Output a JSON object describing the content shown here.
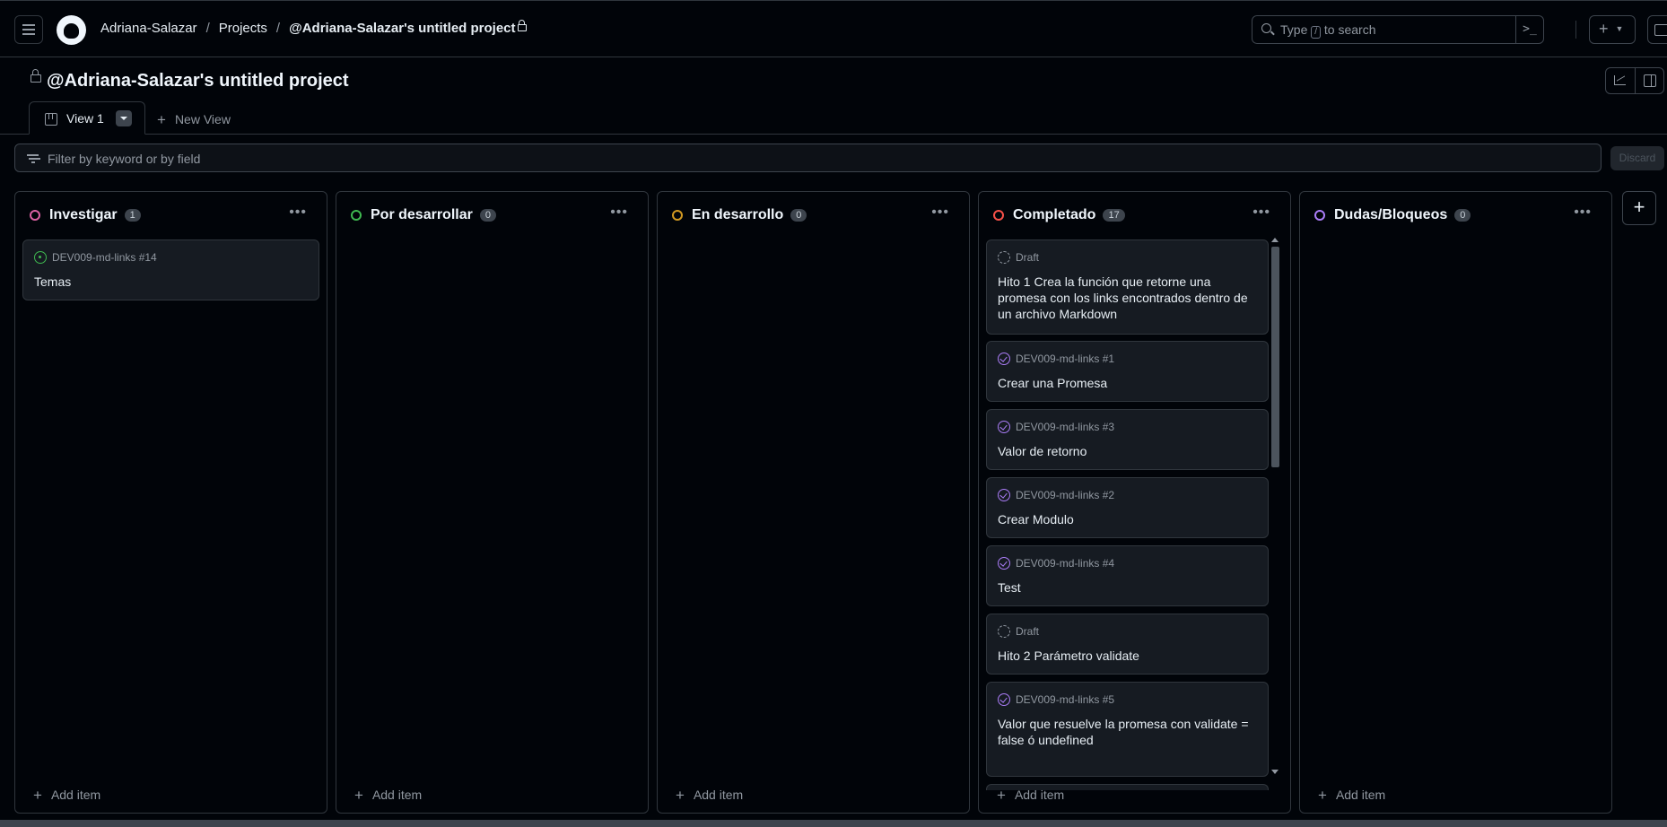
{
  "nav": {
    "owner": "Adriana-Salazar",
    "projects": "Projects",
    "project": "@Adriana-Salazar's untitled project"
  },
  "search": {
    "pre": "Type",
    "key": "/",
    "post": "to search"
  },
  "project": {
    "title": "@Adriana-Salazar's untitled project"
  },
  "tabs": {
    "active": "View 1",
    "new_view": "New View"
  },
  "filter": {
    "placeholder": "Filter by keyword or by field",
    "discard": "Discard"
  },
  "columns": [
    {
      "title": "Investigar",
      "count": "1",
      "color": "#db61a2",
      "add": "Add item",
      "cards": [
        {
          "repo": "DEV009-md-links #14",
          "title": "Temas",
          "state": "open"
        }
      ]
    },
    {
      "title": "Por desarrollar",
      "count": "0",
      "color": "#3fb950",
      "add": "Add item",
      "cards": []
    },
    {
      "title": "En desarrollo",
      "count": "0",
      "color": "#d29922",
      "add": "Add item",
      "cards": []
    },
    {
      "title": "Completado",
      "count": "17",
      "color": "#f85149",
      "add": "Add item",
      "cards": [
        {
          "repo": "Draft",
          "title": "Hito 1 Crea la función que retorne una promesa con los links encontrados dentro de un archivo Markdown",
          "state": "draft"
        },
        {
          "repo": "DEV009-md-links #1",
          "title": "Crear una Promesa",
          "state": "done"
        },
        {
          "repo": "DEV009-md-links #3",
          "title": "Valor de retorno",
          "state": "done"
        },
        {
          "repo": "DEV009-md-links #2",
          "title": "Crear Modulo",
          "state": "done"
        },
        {
          "repo": "DEV009-md-links #4",
          "title": "Test",
          "state": "done"
        },
        {
          "repo": "Draft",
          "title": "Hito 2 Parámetro validate",
          "state": "draft"
        },
        {
          "repo": "DEV009-md-links #5",
          "title": "Valor que resuelve la promesa con validate = false ó undefined",
          "state": "done"
        }
      ]
    },
    {
      "title": "Dudas/Bloqueos",
      "count": "0",
      "color": "#ab7df8",
      "add": "Add item",
      "cards": []
    }
  ]
}
